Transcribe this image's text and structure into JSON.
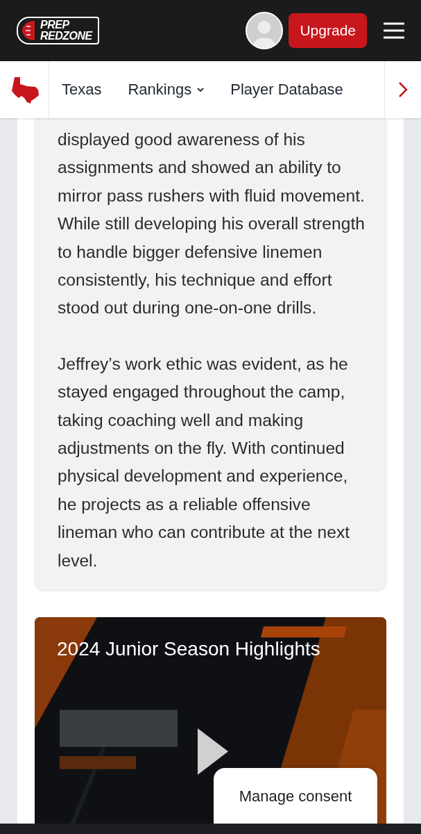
{
  "header": {
    "logo_line_1": "PREP",
    "logo_line_2": "REDZONE",
    "upgrade_button": "Upgrade"
  },
  "nav": {
    "items": [
      {
        "label": "Texas",
        "kind": "link"
      },
      {
        "label": "Rankings",
        "kind": "dropdown"
      },
      {
        "label": "Player Database",
        "kind": "link"
      }
    ]
  },
  "article": {
    "paragraphs": [
      "displayed good awareness of his assignments and showed an ability to mirror pass rushers with fluid movement. While still developing his overall strength to handle bigger defensive linemen consistently, his technique and effort stood out during one-on-one drills.",
      "Jeffrey’s work ethic was evident, as he stayed engaged throughout the camp, taking coaching well and making adjustments on the fly. With continued physical development and experience, he projects as a reliable offensive lineman who can contribute at the next level."
    ]
  },
  "video": {
    "title": "2024 Junior Season Highlights",
    "kind": "picture"
  },
  "consent_button": "Manage consent"
}
